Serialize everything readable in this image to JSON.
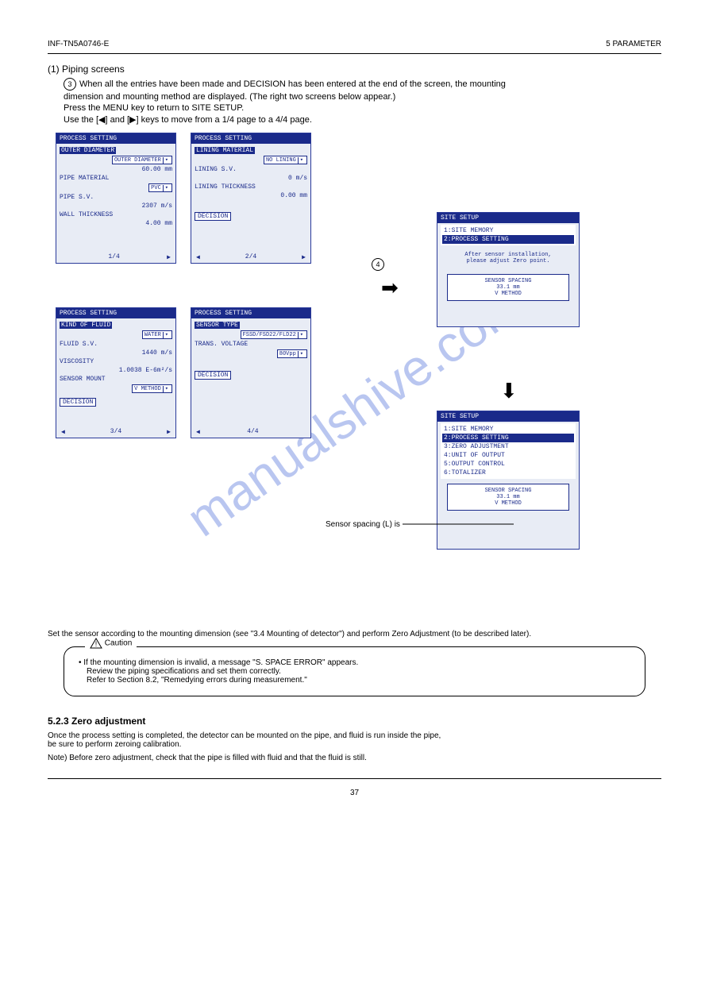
{
  "header": {
    "doc_id": "INF-TN5A0746-E",
    "right_label": "5 PARAMETER"
  },
  "heading": "(1) Piping screens",
  "intro_line1_num": "3",
  "intro_line1": "When all the entries have been made and DECISION has been entered at the end of the screen, the mounting",
  "intro_line2": "dimension and mounting method are displayed. (The right two screens below appear.)",
  "intro_extra1": "Press the MENU key to return to SITE SETUP.",
  "intro_extra2": "Use the [◀] and [▶] keys to move from a 1/4 page to a 4/4 page.",
  "screens": {
    "p1": {
      "title": "PROCESS SETTING",
      "focus": "OUTER DIAMETER",
      "dd1": "OUTER DIAMETER",
      "v1": "60.00 mm",
      "l2": "PIPE MATERIAL",
      "dd2": "PVC",
      "l3": "PIPE S.V.",
      "v3": "2307 m/s",
      "l4": "WALL THICKNESS",
      "v4": "4.00 mm",
      "page": "1/4"
    },
    "p2": {
      "title": "PROCESS SETTING",
      "focus": "LINING MATERIAL",
      "dd1": "NO LINING",
      "l2": "LINING S.V.",
      "v2": "0 m/s",
      "l3": "LINING THICKNESS",
      "v3": "0.00 mm",
      "btn": "DECISION",
      "page": "2/4"
    },
    "p3": {
      "title": "PROCESS SETTING",
      "focus": "KIND OF FLUID",
      "dd1": "WATER",
      "l2": "FLUID S.V.",
      "v2": "1440 m/s",
      "l3": "VISCOSITY",
      "v3": "1.0038 E-6m²/s",
      "l4": "SENSOR MOUNT",
      "dd4": "V METHOD",
      "btn": "DECISION",
      "page": "3/4"
    },
    "p4": {
      "title": "PROCESS SETTING",
      "focus": "SENSOR TYPE",
      "dd1": "FSSD/FSD22/FLD22",
      "l2": "TRANS. VOLTAGE",
      "dd2": "80Vpp",
      "btn": "DECISION",
      "page": "4/4"
    },
    "siteA": {
      "title": "SITE SETUP",
      "menu": [
        "1:SITE MEMORY",
        "2:PROCESS SETTING"
      ],
      "msg1": "After sensor installation,",
      "msg2": "please adjust Zero point.",
      "box_l1": "SENSOR SPACING",
      "box_l2": "33.1 mm",
      "box_l3": "V METHOD"
    },
    "siteB": {
      "title": "SITE SETUP",
      "menu": [
        "1:SITE MEMORY",
        "2:PROCESS SETTING",
        "3:ZERO ADJUSTMENT",
        "4:UNIT OF OUTPUT",
        "5:OUTPUT CONTROL",
        "6:TOTALIZER"
      ],
      "box_l1": "SENSOR SPACING",
      "box_l2": "33.1 mm",
      "box_l3": "V METHOD"
    }
  },
  "annot": {
    "circle4": "4",
    "sensor_spacing": "Sensor spacing (L) is"
  },
  "set_text1": "Set the sensor according to the mounting dimension (see \"3.4 Mounting of detector\") and perform Zero Adjustment (to be described later).",
  "caution": {
    "head": "Caution",
    "bullet": "• If the mounting dimension is invalid, a message \"S. SPACE ERROR\" appears.",
    "bullet2": "Review the piping specifications and set them correctly.",
    "bullet3": "Refer to Section 8.2, \"Remedying errors during measurement.\""
  },
  "section5": {
    "heading": "5.2.3 Zero adjustment",
    "p1": "Once the process setting is completed, the detector can be mounted on the pipe, and fluid is run inside the pipe,",
    "p2": "be sure to perform zeroing calibration.",
    "note_head": "Note)",
    "note_body": "Before zero adjustment, check that the pipe is filled with fluid and that the fluid is still."
  },
  "footer": {
    "left": "",
    "center": "37",
    "right": ""
  },
  "watermark": "manualshive.com"
}
